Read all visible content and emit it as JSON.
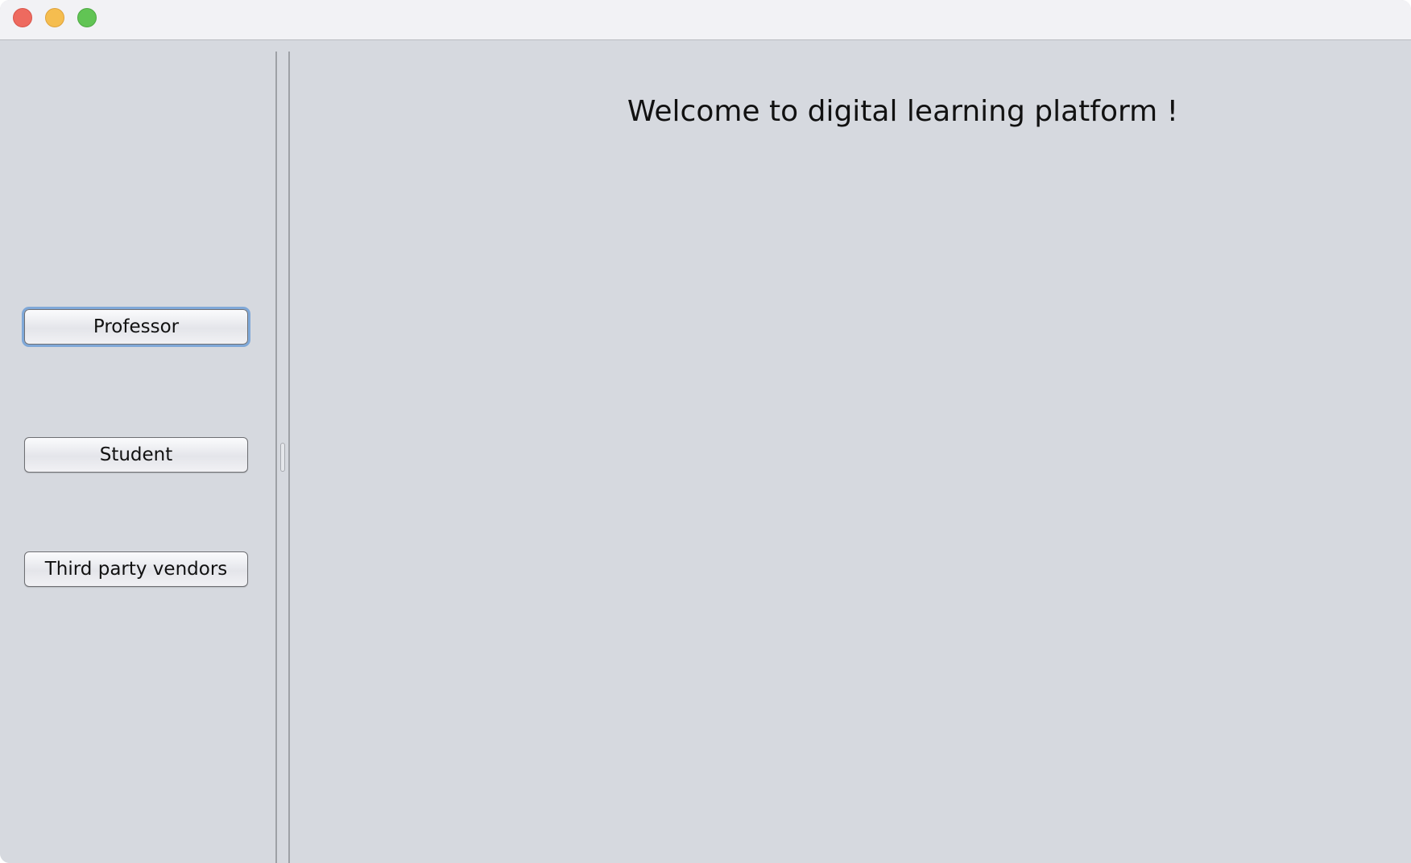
{
  "window": {
    "controls": {
      "close_icon": "close-icon",
      "minimize_icon": "minimize-icon",
      "zoom_icon": "zoom-icon",
      "colors": {
        "close": "#ee6a5f",
        "minimize": "#f5bd4f",
        "zoom": "#61c454"
      }
    }
  },
  "sidebar": {
    "buttons": [
      {
        "label": "Professor",
        "focused": true
      },
      {
        "label": "Student",
        "focused": false
      },
      {
        "label": "Third party vendors",
        "focused": false
      }
    ]
  },
  "main": {
    "welcome_text": "Welcome to digital learning platform !"
  },
  "colors": {
    "background": "#d6d9df",
    "titlebar": "#f2f2f5",
    "focus_ring": "#7fa8d8"
  }
}
